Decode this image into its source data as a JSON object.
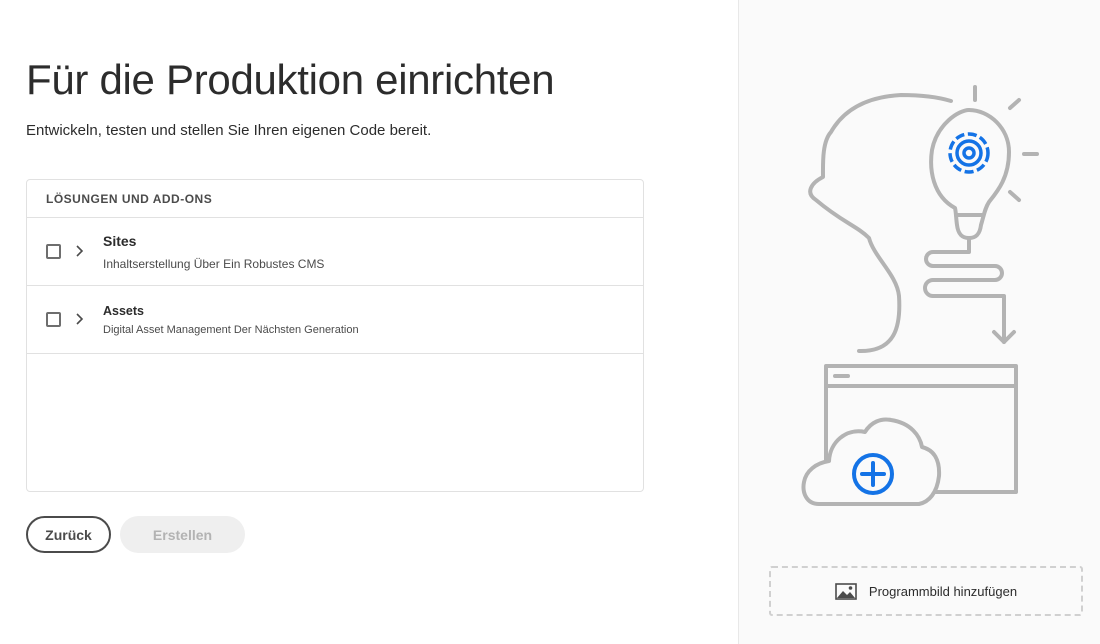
{
  "page": {
    "title": "Für die Produktion einrichten",
    "subtitle": "Entwickeln, testen und stellen Sie Ihren eigenen Code bereit."
  },
  "panel": {
    "header": "LÖSUNGEN UND ADD-ONS",
    "items": [
      {
        "title": "Sites",
        "description": "Inhaltserstellung Über Ein Robustes CMS",
        "checked": false,
        "expanded": false
      },
      {
        "title": "Assets",
        "description": "Digital Asset Management Der Nächsten Generation",
        "checked": false,
        "expanded": false
      }
    ]
  },
  "buttons": {
    "back": "Zurück",
    "create": "Erstellen"
  },
  "sidebar": {
    "add_image_label": "Programmbild hinzufügen",
    "icons": [
      "head-lightbulb-gear-illustration",
      "cloud-add-icon",
      "image-icon"
    ]
  },
  "colors": {
    "accent_blue": "#1473e6",
    "illustration_gray": "#b3b3b3",
    "text": "#2c2c2c",
    "disabled_bg": "#efefef",
    "disabled_text": "#b3b3b3"
  }
}
